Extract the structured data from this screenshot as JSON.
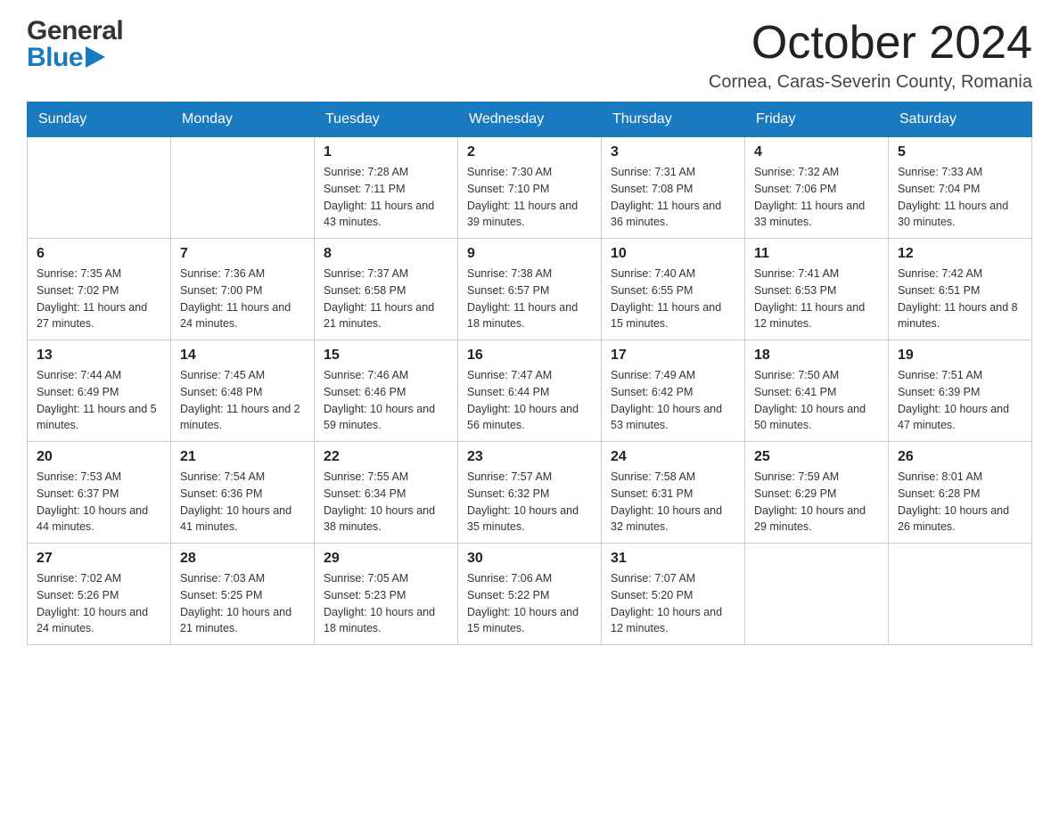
{
  "header": {
    "logo_general": "General",
    "logo_blue": "Blue",
    "month_year": "October 2024",
    "location": "Cornea, Caras-Severin County, Romania"
  },
  "days_of_week": [
    "Sunday",
    "Monday",
    "Tuesday",
    "Wednesday",
    "Thursday",
    "Friday",
    "Saturday"
  ],
  "weeks": [
    [
      {
        "day": "",
        "info": ""
      },
      {
        "day": "",
        "info": ""
      },
      {
        "day": "1",
        "info": "Sunrise: 7:28 AM\nSunset: 7:11 PM\nDaylight: 11 hours\nand 43 minutes."
      },
      {
        "day": "2",
        "info": "Sunrise: 7:30 AM\nSunset: 7:10 PM\nDaylight: 11 hours\nand 39 minutes."
      },
      {
        "day": "3",
        "info": "Sunrise: 7:31 AM\nSunset: 7:08 PM\nDaylight: 11 hours\nand 36 minutes."
      },
      {
        "day": "4",
        "info": "Sunrise: 7:32 AM\nSunset: 7:06 PM\nDaylight: 11 hours\nand 33 minutes."
      },
      {
        "day": "5",
        "info": "Sunrise: 7:33 AM\nSunset: 7:04 PM\nDaylight: 11 hours\nand 30 minutes."
      }
    ],
    [
      {
        "day": "6",
        "info": "Sunrise: 7:35 AM\nSunset: 7:02 PM\nDaylight: 11 hours\nand 27 minutes."
      },
      {
        "day": "7",
        "info": "Sunrise: 7:36 AM\nSunset: 7:00 PM\nDaylight: 11 hours\nand 24 minutes."
      },
      {
        "day": "8",
        "info": "Sunrise: 7:37 AM\nSunset: 6:58 PM\nDaylight: 11 hours\nand 21 minutes."
      },
      {
        "day": "9",
        "info": "Sunrise: 7:38 AM\nSunset: 6:57 PM\nDaylight: 11 hours\nand 18 minutes."
      },
      {
        "day": "10",
        "info": "Sunrise: 7:40 AM\nSunset: 6:55 PM\nDaylight: 11 hours\nand 15 minutes."
      },
      {
        "day": "11",
        "info": "Sunrise: 7:41 AM\nSunset: 6:53 PM\nDaylight: 11 hours\nand 12 minutes."
      },
      {
        "day": "12",
        "info": "Sunrise: 7:42 AM\nSunset: 6:51 PM\nDaylight: 11 hours\nand 8 minutes."
      }
    ],
    [
      {
        "day": "13",
        "info": "Sunrise: 7:44 AM\nSunset: 6:49 PM\nDaylight: 11 hours\nand 5 minutes."
      },
      {
        "day": "14",
        "info": "Sunrise: 7:45 AM\nSunset: 6:48 PM\nDaylight: 11 hours\nand 2 minutes."
      },
      {
        "day": "15",
        "info": "Sunrise: 7:46 AM\nSunset: 6:46 PM\nDaylight: 10 hours\nand 59 minutes."
      },
      {
        "day": "16",
        "info": "Sunrise: 7:47 AM\nSunset: 6:44 PM\nDaylight: 10 hours\nand 56 minutes."
      },
      {
        "day": "17",
        "info": "Sunrise: 7:49 AM\nSunset: 6:42 PM\nDaylight: 10 hours\nand 53 minutes."
      },
      {
        "day": "18",
        "info": "Sunrise: 7:50 AM\nSunset: 6:41 PM\nDaylight: 10 hours\nand 50 minutes."
      },
      {
        "day": "19",
        "info": "Sunrise: 7:51 AM\nSunset: 6:39 PM\nDaylight: 10 hours\nand 47 minutes."
      }
    ],
    [
      {
        "day": "20",
        "info": "Sunrise: 7:53 AM\nSunset: 6:37 PM\nDaylight: 10 hours\nand 44 minutes."
      },
      {
        "day": "21",
        "info": "Sunrise: 7:54 AM\nSunset: 6:36 PM\nDaylight: 10 hours\nand 41 minutes."
      },
      {
        "day": "22",
        "info": "Sunrise: 7:55 AM\nSunset: 6:34 PM\nDaylight: 10 hours\nand 38 minutes."
      },
      {
        "day": "23",
        "info": "Sunrise: 7:57 AM\nSunset: 6:32 PM\nDaylight: 10 hours\nand 35 minutes."
      },
      {
        "day": "24",
        "info": "Sunrise: 7:58 AM\nSunset: 6:31 PM\nDaylight: 10 hours\nand 32 minutes."
      },
      {
        "day": "25",
        "info": "Sunrise: 7:59 AM\nSunset: 6:29 PM\nDaylight: 10 hours\nand 29 minutes."
      },
      {
        "day": "26",
        "info": "Sunrise: 8:01 AM\nSunset: 6:28 PM\nDaylight: 10 hours\nand 26 minutes."
      }
    ],
    [
      {
        "day": "27",
        "info": "Sunrise: 7:02 AM\nSunset: 5:26 PM\nDaylight: 10 hours\nand 24 minutes."
      },
      {
        "day": "28",
        "info": "Sunrise: 7:03 AM\nSunset: 5:25 PM\nDaylight: 10 hours\nand 21 minutes."
      },
      {
        "day": "29",
        "info": "Sunrise: 7:05 AM\nSunset: 5:23 PM\nDaylight: 10 hours\nand 18 minutes."
      },
      {
        "day": "30",
        "info": "Sunrise: 7:06 AM\nSunset: 5:22 PM\nDaylight: 10 hours\nand 15 minutes."
      },
      {
        "day": "31",
        "info": "Sunrise: 7:07 AM\nSunset: 5:20 PM\nDaylight: 10 hours\nand 12 minutes."
      },
      {
        "day": "",
        "info": ""
      },
      {
        "day": "",
        "info": ""
      }
    ]
  ]
}
